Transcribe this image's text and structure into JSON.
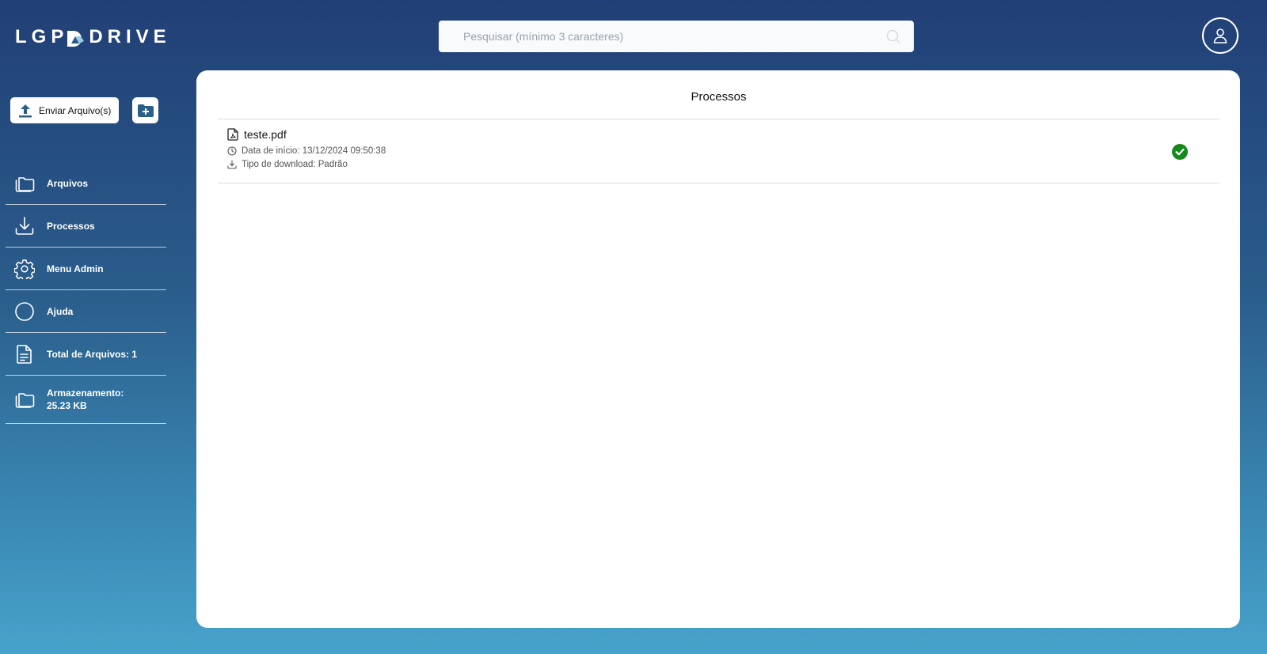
{
  "brand": {
    "name": "LGPDRIVE",
    "prefix": "LGP",
    "suffix": "DRIVE"
  },
  "search": {
    "placeholder": "Pesquisar (mínimo 3 caracteres)",
    "icon": "search-icon"
  },
  "header": {
    "user_icon": "user-icon"
  },
  "actions": {
    "upload_label": "Enviar Arquivo(s)",
    "upload_icon": "upload-icon",
    "new_folder_icon": "folder-plus-icon"
  },
  "sidebar": {
    "items": [
      {
        "label": "Arquivos",
        "icon": "folders-icon"
      },
      {
        "label": "Processos",
        "icon": "download-icon"
      },
      {
        "label": "Menu Admin",
        "icon": "gear-icon"
      },
      {
        "label": "Ajuda",
        "icon": "circle-icon"
      },
      {
        "label": "Total de Arquivos: 1",
        "icon": "document-icon"
      },
      {
        "label": "Armazenamento: 25.23 KB",
        "icon": "folders-icon"
      }
    ]
  },
  "main": {
    "title": "Processos",
    "processes": [
      {
        "file_name": "teste.pdf",
        "start_date": "Data de início: 13/12/2024 09:50:38",
        "download_type": "Tipo de download: Padrão",
        "status": "completed",
        "status_color": "#15891b"
      }
    ]
  },
  "colors": {
    "accent": "#2b5f87",
    "gradient_top": "#213f76",
    "gradient_bottom": "#47a3cb"
  }
}
